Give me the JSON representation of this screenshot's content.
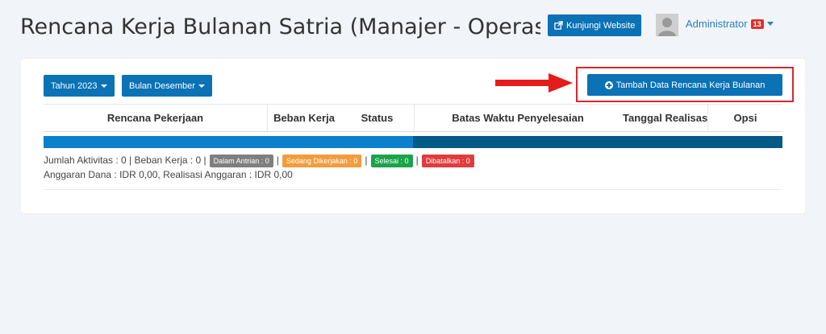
{
  "header": {
    "title": "Rencana Kerja Bulanan Satria (Manajer - Operasional)",
    "visit_label": "Kunjungi Website",
    "user_name": "Administrator",
    "notif_count": "13"
  },
  "toolbar": {
    "year_label": "Tahun 2023",
    "month_label": "Bulan Desember",
    "add_label": "Tambah Data Rencana Kerja Bulanan"
  },
  "table": {
    "columns": [
      "Rencana Pekerjaan",
      "Beban Kerja",
      "Status",
      "Batas Waktu Penyelesaian",
      "Tanggal Realisasi",
      "Opsi"
    ]
  },
  "progress": {
    "fraction": 0.5
  },
  "summary": {
    "prefix": "Jumlah Aktivitas : 0 | Beban Kerja : 0 |",
    "sep": "|",
    "badges": [
      {
        "label": "Dalam Antrian : 0",
        "color": "#7f7f7f"
      },
      {
        "label": "Sedang Dikerjakan : 0",
        "color": "#f39c3c"
      },
      {
        "label": "Selesai : 0",
        "color": "#1aa34a"
      },
      {
        "label": "Dibatalkan : 0",
        "color": "#e03c3c"
      }
    ],
    "budget": "Anggaran Dana : IDR 0,00, Realisasi Anggaran : IDR 0,00"
  },
  "colors": {
    "primary": "#0a72b5",
    "highlight": "#d9262e",
    "bar_dark": "#035a86",
    "bar_light": "#0b80cc"
  }
}
